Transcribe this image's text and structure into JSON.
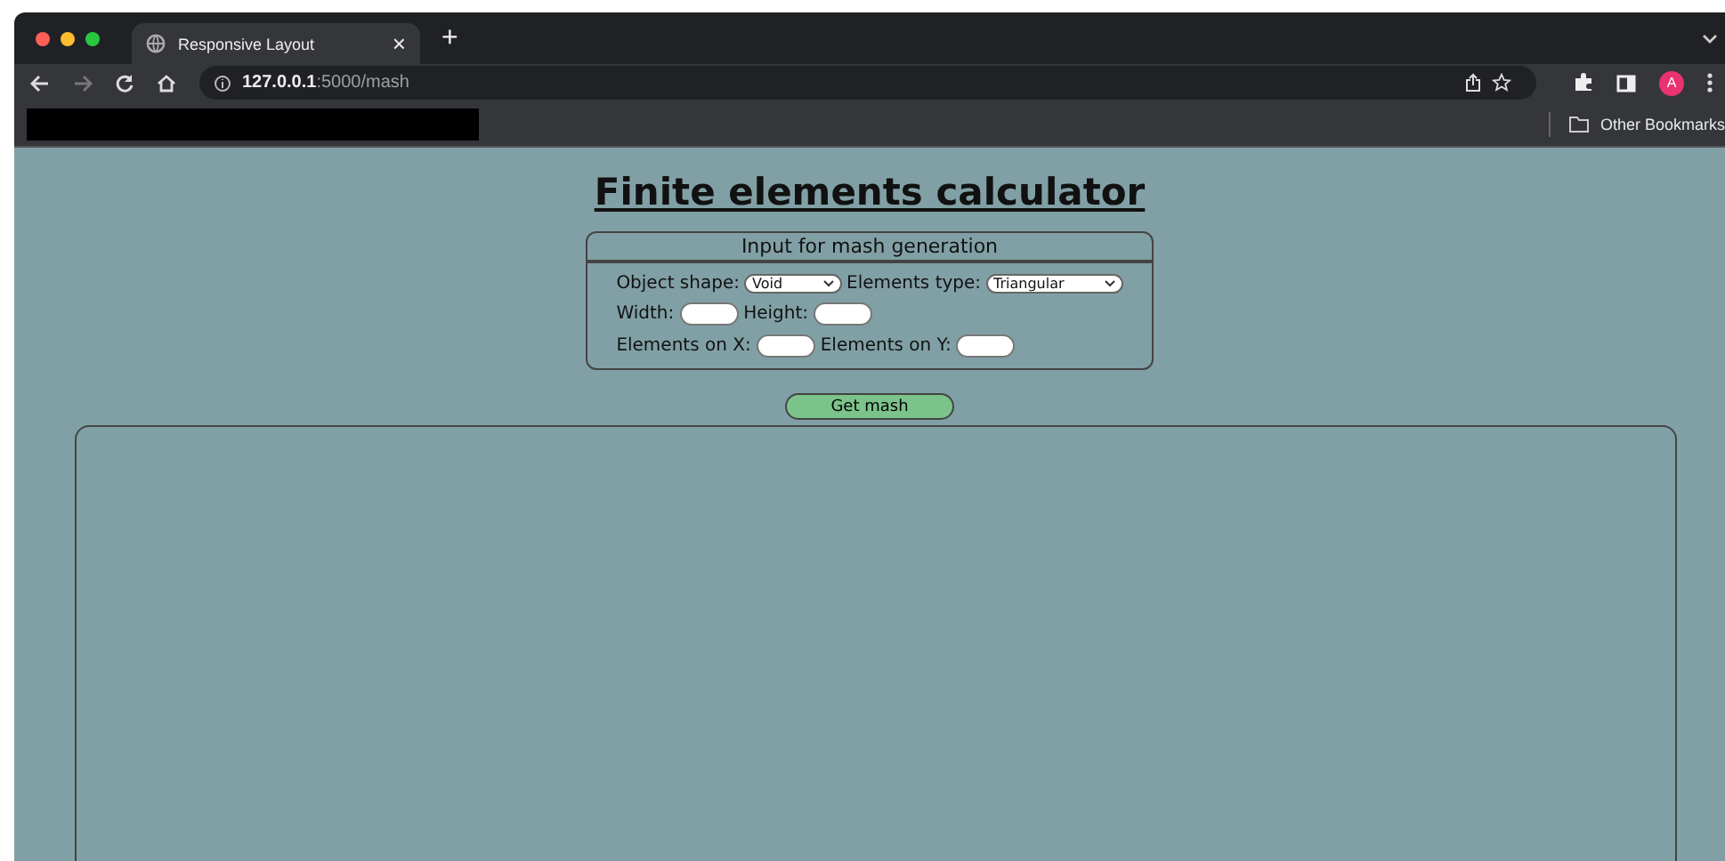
{
  "browser": {
    "tab": {
      "title": "Responsive Layout",
      "close": "×"
    },
    "new_tab": "+",
    "address": {
      "host": "127.0.0.1",
      "rest": ":5000/mash"
    },
    "bookmarks": {
      "other": "Other Bookmarks"
    },
    "profile": "A"
  },
  "page": {
    "title": "Finite elements calculator",
    "form": {
      "legend": "Input for mash generation",
      "rows": [
        [
          {
            "kind": "select",
            "label": "Object shape:",
            "value": "Void"
          },
          {
            "kind": "select",
            "label": "Elements type:",
            "value": "Triangular"
          }
        ],
        [
          {
            "kind": "input",
            "label": "Width:"
          },
          {
            "kind": "input",
            "label": "Height:"
          }
        ],
        [
          {
            "kind": "input",
            "label": "Elements on X:"
          },
          {
            "kind": "input",
            "label": "Elements on Y:"
          }
        ]
      ]
    },
    "button": "Get mash"
  }
}
